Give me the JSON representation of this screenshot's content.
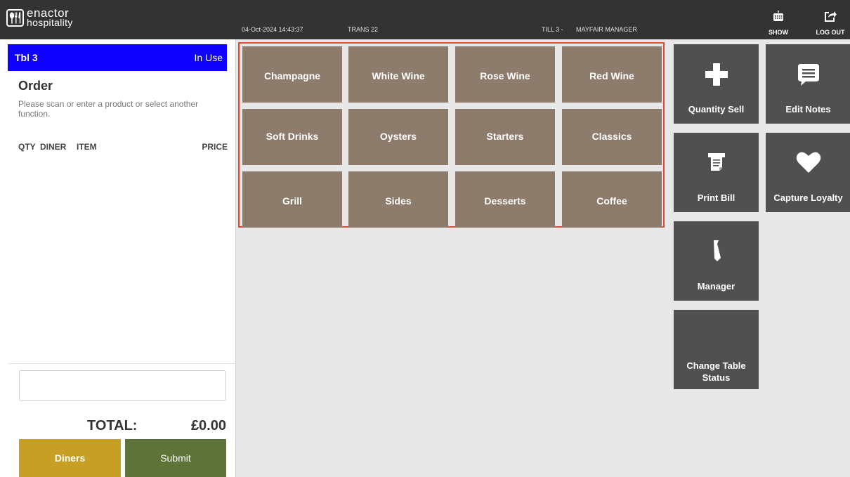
{
  "app": {
    "logo_line1": "enactor",
    "logo_line2": "hospitality"
  },
  "status": {
    "datetime": "04-Oct-2024 14:43:37",
    "transaction": "TRANS 22",
    "till": "TILL 3 -",
    "user": "MAYFAIR MANAGER"
  },
  "top_buttons": {
    "show": "SHOW",
    "logout": "LOG OUT"
  },
  "table": {
    "name": "Tbl 3",
    "status": "In Use"
  },
  "order": {
    "title": "Order",
    "prompt": "Please scan or enter a product or select another function.",
    "columns": {
      "qty": "QTY",
      "diner": "DINER",
      "item": "ITEM",
      "price": "PRICE"
    },
    "input_value": "",
    "total_label": "TOTAL:",
    "total_value": "£0.00"
  },
  "actions": {
    "diners": "Diners",
    "submit": "Submit"
  },
  "categories": [
    "Champagne",
    "White Wine",
    "Rose Wine",
    "Red Wine",
    "Soft Drinks",
    "Oysters",
    "Starters",
    "Classics",
    "Grill",
    "Sides",
    "Desserts",
    "Coffee"
  ],
  "functions": {
    "quantity_sell": "Quantity Sell",
    "edit_notes": "Edit Notes",
    "print_bill": "Print Bill",
    "capture_loyalty": "Capture Loyalty",
    "manager": "Manager",
    "change_table_status_1": "Change Table",
    "change_table_status_2": "Status"
  },
  "colors": {
    "topbar": "#333333",
    "table_bar": "#0f00ff",
    "category_tile": "#8d7c6b",
    "category_frame": "#e8462e",
    "function_tile": "#505050",
    "diners_button": "#c89f25",
    "submit_button": "#5e7338"
  },
  "icons": {
    "logo": "cutlery-logo-icon",
    "show": "keyboard-icon",
    "logout": "logout-icon",
    "quantity_sell": "plus-icon",
    "edit_notes": "note-icon",
    "print_bill": "receipt-printer-icon",
    "capture_loyalty": "heart-icon",
    "manager": "tie-icon"
  }
}
